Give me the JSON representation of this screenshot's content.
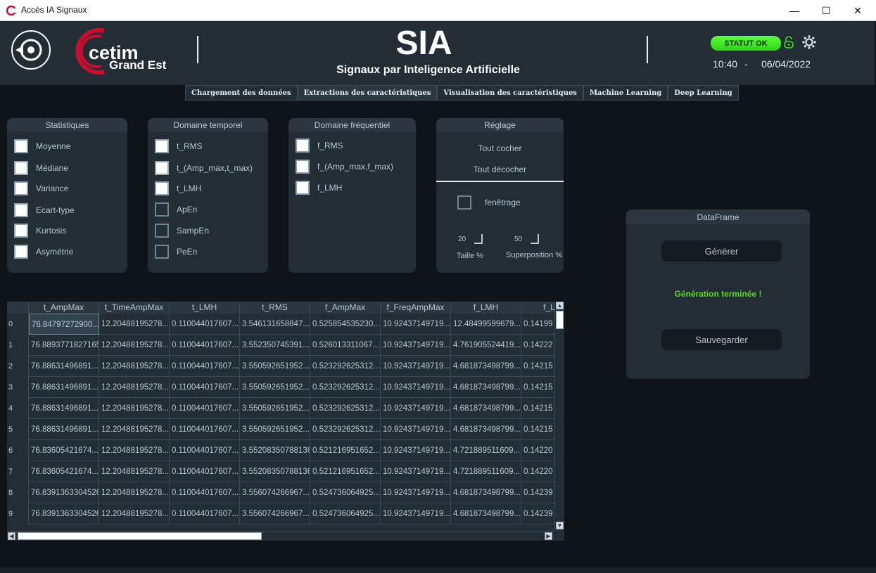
{
  "window": {
    "title": "Accès IA Signaux",
    "min": "—",
    "max": "☐",
    "close": "✕"
  },
  "header": {
    "title": "SIA",
    "subtitle": "Signaux par Inteligence Artificielle",
    "status": "STATUT OK",
    "time": "10:40",
    "dash": "-",
    "date": "06/04/2022",
    "logos": {
      "cetim": "cetim",
      "grand_est": "Grand Est"
    },
    "colors": {
      "status_green": "#3ee020",
      "lock_green": "#3ee020"
    }
  },
  "tabs": [
    {
      "label": "Chargement des données"
    },
    {
      "label": "Extractions des caractéristiques"
    },
    {
      "label": "Visualisation des caractéristiques"
    },
    {
      "label": "Machine Learning"
    },
    {
      "label": "Deep Learning"
    }
  ],
  "panels": {
    "stats": {
      "title": "Statistiques",
      "items": [
        {
          "label": "Moyenne",
          "checked": true
        },
        {
          "label": "Médiane",
          "checked": true
        },
        {
          "label": "Variance",
          "checked": true
        },
        {
          "label": "Ecart-type",
          "checked": true
        },
        {
          "label": "Kurtosis",
          "checked": true
        },
        {
          "label": "Asymétrie",
          "checked": true
        }
      ]
    },
    "temporal": {
      "title": "Domaine temporel",
      "items": [
        {
          "label": "t_RMS",
          "checked": true
        },
        {
          "label": "t_(Amp_max,t_max)",
          "checked": true
        },
        {
          "label": "t_LMH",
          "checked": true
        },
        {
          "label": "ApEn",
          "checked": false
        },
        {
          "label": "SampEn",
          "checked": false
        },
        {
          "label": "PeEn",
          "checked": false
        }
      ]
    },
    "frequency": {
      "title": "Domaine fréquentiel",
      "items": [
        {
          "label": "f_RMS",
          "checked": true
        },
        {
          "label": "f_(Amp_max,f_max)",
          "checked": true
        },
        {
          "label": "f_LMH",
          "checked": true
        }
      ]
    },
    "settings": {
      "title": "Réglage",
      "check_all": "Tout cocher",
      "uncheck_all": "Tout décocher",
      "windowing": "fenêtrage",
      "size_value": "20",
      "overlap_value": "50",
      "size_label": "Taille %",
      "overlap_label": "Superposition %"
    }
  },
  "table": {
    "columns": [
      "t_AmpMax",
      "t_TimeAmpMax",
      "t_LMH",
      "t_RMS",
      "f_AmpMax",
      "f_FreqAmpMax",
      "f_LMH",
      "f_L"
    ],
    "rows": [
      {
        "index": "0",
        "cells": [
          "76.84797272900...",
          "12.20488195278...",
          "0.110044017607...",
          "3.546131658847...",
          "0.525854535230...",
          "10.92437149719...",
          "12.48499599679...",
          "0.14199"
        ]
      },
      {
        "index": "1",
        "cells": [
          "76.8893771827165",
          "12.20488195278...",
          "0.110044017607...",
          "3.552350745391...",
          "0.526013311067...",
          "10.92437149719...",
          "4.761905524419...",
          "0.14222"
        ]
      },
      {
        "index": "2",
        "cells": [
          "76.88631496891...",
          "12.20488195278...",
          "0.110044017607...",
          "3.550592651952...",
          "0.523292625312...",
          "10.92437149719...",
          "4.681873498799...",
          "0.14215"
        ]
      },
      {
        "index": "3",
        "cells": [
          "76.88631496891...",
          "12.20488195278...",
          "0.110044017607...",
          "3.550592651952...",
          "0.523292625312...",
          "10.92437149719...",
          "4.681873498799...",
          "0.14215"
        ]
      },
      {
        "index": "4",
        "cells": [
          "76.88631496891...",
          "12.20488195278...",
          "0.110044017607...",
          "3.550592651952...",
          "0.523292625312...",
          "10.92437149719...",
          "4.681873498799...",
          "0.14215"
        ]
      },
      {
        "index": "5",
        "cells": [
          "76.88631496891...",
          "12.20488195278...",
          "0.110044017607...",
          "3.550592651952...",
          "0.523292625312...",
          "10.92437149719...",
          "4.681873498799...",
          "0.14215"
        ]
      },
      {
        "index": "6",
        "cells": [
          "76.83605421674...",
          "12.20488195278...",
          "0.110044017607...",
          "3.55208350788136",
          "0.521216951652...",
          "10.92437149719...",
          "4.721889511609...",
          "0.14220"
        ]
      },
      {
        "index": "7",
        "cells": [
          "76.83605421674...",
          "12.20488195278...",
          "0.110044017607...",
          "3.55208350788136",
          "0.521216951652...",
          "10.92437149719...",
          "4.721889511609...",
          "0.14220"
        ]
      },
      {
        "index": "8",
        "cells": [
          "76.8391363304526",
          "12.20488195278...",
          "0.110044017607...",
          "3.556074266967...",
          "0.524736064925...",
          "10.92437149719...",
          "4.681873498799...",
          "0.14239"
        ]
      },
      {
        "index": "9",
        "cells": [
          "76.8391363304526",
          "12.20488195278...",
          "0.110044017607...",
          "3.556074266967...",
          "0.524736064925...",
          "10.92437149719...",
          "4.681873498799...",
          "0.14239"
        ]
      }
    ]
  },
  "dataframe": {
    "title": "DataFrame",
    "generate": "Générer",
    "status": "Génération terminée !",
    "save": "Sauvegarder"
  }
}
